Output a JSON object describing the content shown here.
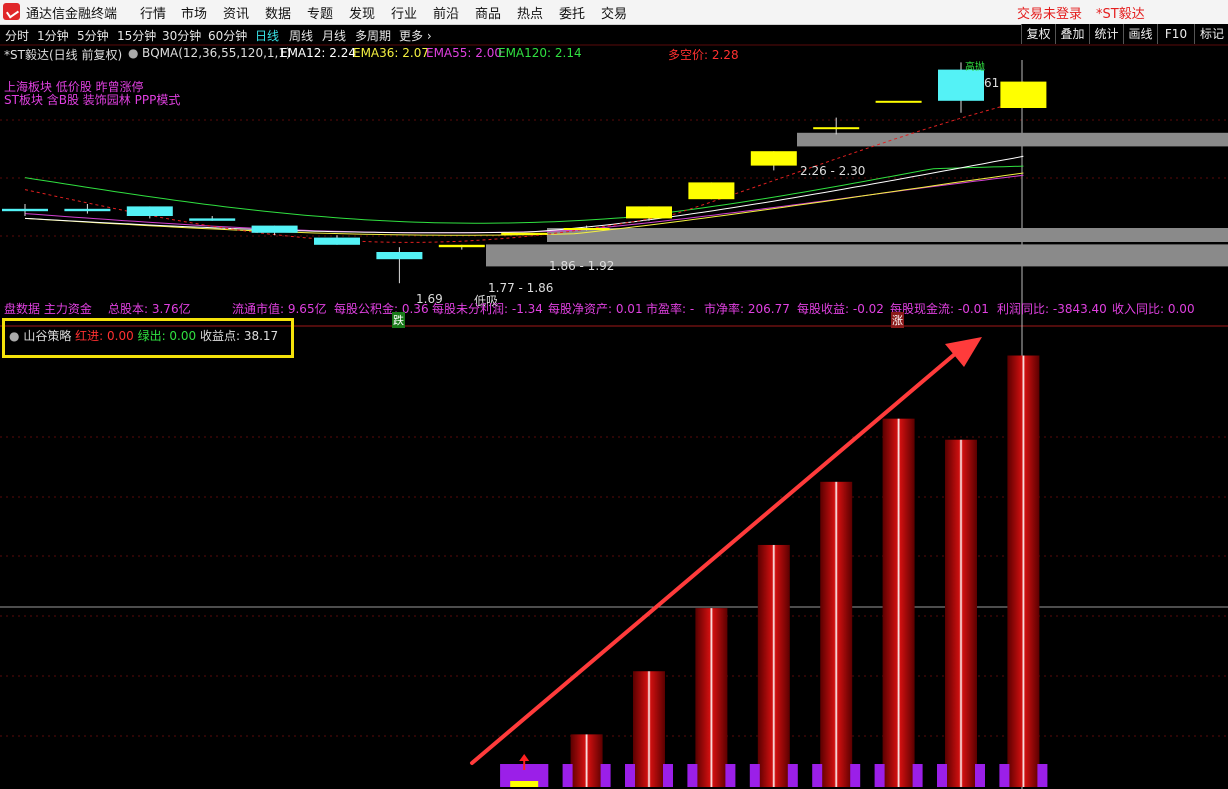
{
  "app": {
    "title": "通达信金融终端"
  },
  "menu": [
    "行情",
    "市场",
    "资讯",
    "数据",
    "专题",
    "发现",
    "行业",
    "前沿",
    "商品",
    "热点",
    "委托",
    "交易"
  ],
  "menu_right": {
    "login": "交易未登录",
    "stock": "*ST毅达"
  },
  "periods": [
    "分时",
    "1分钟",
    "5分钟",
    "15分钟",
    "30分钟",
    "60分钟",
    "日线",
    "周线",
    "月线",
    "多周期",
    "更多"
  ],
  "active_period": "日线",
  "toolbar": [
    "复权",
    "叠加",
    "统计",
    "画线",
    "F10",
    "标记"
  ],
  "indicator_line": {
    "symbol": "*ST毅达(日线 前复权)",
    "bqma": "BQMA(12,36,55,120,1,1)",
    "ema12": "EMA12: 2.24",
    "ema36": "EMA36: 2.07",
    "ema55": "EMA55: 2.00",
    "ema120": "EMA120: 2.14",
    "duokong": "多空价: 2.28"
  },
  "tags": {
    "line1": "上海板块 低价股 昨曾涨停",
    "line2": "ST板块 含B股 装饰园林 PPP模式"
  },
  "price_labels": {
    "zone_upper": "2.26 - 2.30",
    "zone_lower": "1.86 - 1.92",
    "zone_min": "1.77 - 1.86",
    "low_value": "1.69",
    "low_tag": "低吸",
    "high_value": "61",
    "high_tag": "高抛",
    "down_marker": "跌",
    "up_marker": "涨"
  },
  "info_strip": {
    "partial_left": "盘数据 主力资金",
    "total_share": "总股本: 3.76亿",
    "float_mv": "流通市值: 9.65亿",
    "reserve": "每股公积金: 0.36",
    "undistributed": "每股未分利润: -1.34",
    "nav": "每股净资产: 0.01",
    "pe": "市盈率: -",
    "pb": "市净率: 206.77",
    "eps": "每股收益: -0.02",
    "cashflow": "每股现金流: -0.01",
    "profit_yoy": "利润同比: -3843.40",
    "revenue_yoy": "收入同比: 0.00"
  },
  "strategy": {
    "name": "山谷策略",
    "red_in": "红进: 0.00",
    "green_out": "绿出: 0.00",
    "profit_points": "收益点: 38.17"
  },
  "colors": {
    "bg": "#000000",
    "cyan_candle": "#54f2f6",
    "yellow_candle": "#ffff00",
    "bar_red": "#c80a0a",
    "purple": "#9b1fe8",
    "magenta_text": "#e040e0",
    "zone_gray": "#8a8a8a",
    "highlight": "#f5e20a",
    "arrow": "#ff3b3b"
  },
  "chart_data": [
    {
      "type": "candlestick",
      "unit": "CNY",
      "candles": [
        {
          "open": 1.99,
          "close": 2.0,
          "high": 2.02,
          "low": 1.97,
          "color": "cyan"
        },
        {
          "open": 1.99,
          "close": 2.0,
          "high": 2.02,
          "low": 1.98,
          "color": "cyan"
        },
        {
          "open": 2.01,
          "close": 1.97,
          "high": 2.01,
          "low": 1.96,
          "color": "cyan"
        },
        {
          "open": 1.96,
          "close": 1.95,
          "high": 1.97,
          "low": 1.95,
          "color": "cyan"
        },
        {
          "open": 1.93,
          "close": 1.9,
          "high": 1.93,
          "low": 1.89,
          "color": "cyan"
        },
        {
          "open": 1.88,
          "close": 1.85,
          "high": 1.89,
          "low": 1.85,
          "color": "cyan"
        },
        {
          "open": 1.82,
          "close": 1.79,
          "high": 1.84,
          "low": 1.69,
          "color": "cyan"
        },
        {
          "open": 1.84,
          "close": 1.85,
          "high": 1.85,
          "low": 1.83,
          "color": "yellow"
        },
        {
          "open": 1.9,
          "close": 1.9,
          "high": 1.9,
          "low": 1.9,
          "color": "yellow"
        },
        {
          "open": 1.92,
          "close": 1.92,
          "high": 1.93,
          "low": 1.91,
          "color": "yellow"
        },
        {
          "open": 1.96,
          "close": 2.01,
          "high": 2.01,
          "low": 1.95,
          "color": "yellow"
        },
        {
          "open": 2.04,
          "close": 2.11,
          "high": 2.11,
          "low": 2.04,
          "color": "yellow"
        },
        {
          "open": 2.18,
          "close": 2.24,
          "high": 2.24,
          "low": 2.16,
          "color": "yellow"
        },
        {
          "open": 2.34,
          "close": 2.34,
          "high": 2.38,
          "low": 2.31,
          "color": "yellow"
        },
        {
          "open": 2.45,
          "close": 2.45,
          "high": 2.45,
          "low": 2.45,
          "color": "yellow"
        },
        {
          "open": 2.45,
          "close": 2.58,
          "high": 2.61,
          "low": 2.4,
          "color": "cyan"
        },
        {
          "open": 2.53,
          "close": 2.42,
          "high": 2.53,
          "low": 2.42,
          "color": "yellow"
        }
      ],
      "ylim": [
        1.62,
        2.62
      ]
    },
    {
      "type": "bar",
      "name": "山谷策略",
      "values": [
        0,
        0,
        0,
        0,
        0,
        0,
        0,
        0,
        0,
        2.5,
        5.5,
        8.5,
        11.5,
        14.5,
        17.5,
        16.5,
        20.5
      ],
      "ylim": [
        0,
        21
      ]
    }
  ]
}
